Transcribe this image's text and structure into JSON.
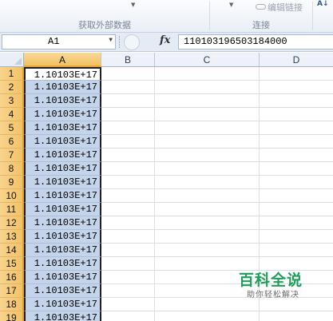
{
  "ribbon": {
    "group_external_data_label": "获取外部数据",
    "group_connections_label": "连接",
    "edit_links_label": "编辑链接",
    "sort_icon": "sort-az-icon"
  },
  "formula_bar": {
    "name_box_value": "A1",
    "fx_label": "fx",
    "formula_value": "110103196503184000"
  },
  "columns": [
    "A",
    "B",
    "C",
    "D"
  ],
  "selected_column": "A",
  "rows": [
    {
      "num": "1",
      "a": "1.10103E+17"
    },
    {
      "num": "2",
      "a": "1.10103E+17"
    },
    {
      "num": "3",
      "a": "1.10103E+17"
    },
    {
      "num": "4",
      "a": "1.10103E+17"
    },
    {
      "num": "5",
      "a": "1.10103E+17"
    },
    {
      "num": "6",
      "a": "1.10103E+17"
    },
    {
      "num": "7",
      "a": "1.10103E+17"
    },
    {
      "num": "8",
      "a": "1.10103E+17"
    },
    {
      "num": "9",
      "a": "1.10103E+17"
    },
    {
      "num": "10",
      "a": "1.10103E+17"
    },
    {
      "num": "11",
      "a": "1.10103E+17"
    },
    {
      "num": "12",
      "a": "1.10103E+17"
    },
    {
      "num": "13",
      "a": "1.10103E+17"
    },
    {
      "num": "14",
      "a": "1.10103E+17"
    },
    {
      "num": "15",
      "a": "1.10103E+17"
    },
    {
      "num": "16",
      "a": "1.10103E+17"
    },
    {
      "num": "17",
      "a": "1.10103E+17"
    },
    {
      "num": "18",
      "a": "1.10103E+17"
    },
    {
      "num": "19",
      "a": "1.10103E+17"
    }
  ],
  "watermark": {
    "logo": "百科全说",
    "subtitle": "助你轻松解决"
  }
}
